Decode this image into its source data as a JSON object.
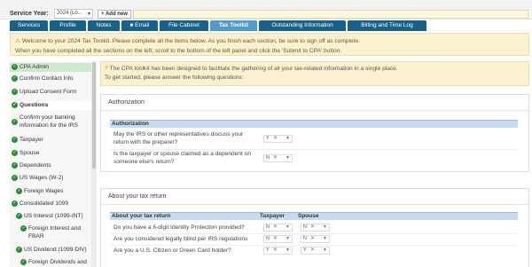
{
  "topbar": {
    "service_year_label": "Service Year:",
    "year_value": "2024 (Lo...",
    "add_new": "+ Add new"
  },
  "tabs": [
    {
      "label": "Services"
    },
    {
      "label": "Profile"
    },
    {
      "label": "Notes"
    },
    {
      "label": "Email"
    },
    {
      "label": "File Cabinet"
    },
    {
      "label": "Tax Toolkit"
    },
    {
      "label": "Outstanding Information"
    },
    {
      "label": "Billing and Time Log"
    }
  ],
  "banner": {
    "line1": "Welcome to your 2024 Tax Toolkit. Please complete all the items below. As you finish each section, be sure to sign off as complete.",
    "line2": "When you have completed all the sections on the left, scroll to the bottom of the left panel and click the 'Submit to CPA' button."
  },
  "sidebar": {
    "items": [
      {
        "label": "CPA Admin"
      },
      {
        "label": "Confirm Contact Info"
      },
      {
        "label": "Upload Consent Form"
      },
      {
        "label": "Questions"
      },
      {
        "label": "Confirm your banking"
      },
      {
        "label": "information for the IRS"
      },
      {
        "label": "Taxpayer"
      },
      {
        "label": "Spouse"
      },
      {
        "label": "Dependents"
      },
      {
        "label": "US Wages (W-2)"
      },
      {
        "label": "Foreign Wages"
      },
      {
        "label": "Consolidated 1099"
      },
      {
        "label": "US Interest (1099-INT)"
      },
      {
        "label": "Foreign Interest and"
      },
      {
        "label": "FBAR"
      },
      {
        "label": "US Dividend (1099-DIV)"
      },
      {
        "label": "Foreign Dividends and"
      }
    ]
  },
  "info": {
    "line1": "The CPA toolkit has been designed to facilitate the gathering of all your tax-related information in a single place.",
    "line2": "To get started, please answer the following questions:"
  },
  "authorization": {
    "panel_title": "Authorization",
    "section_header": "Authorization",
    "questions": [
      {
        "line1": "May the IRS or other representatives discuss your",
        "line2": "return with the preparer?",
        "value": "Y"
      },
      {
        "line1": "Is the taxpayer or spouse claimed as a dependent on",
        "line2": "someone else's return?",
        "value": "N"
      }
    ]
  },
  "about": {
    "panel_title": "About your tax return",
    "section_header": "About your tax return",
    "col_taxpayer": "Taxpayer",
    "col_spouse": "Spouse",
    "questions": [
      {
        "text": "Do you have a 6-digit Identity Protection provided?",
        "taxpayer": "N",
        "spouse": "N"
      },
      {
        "text": "Are you considered legally blind per IRS regulations",
        "taxpayer": "N",
        "spouse": "N"
      },
      {
        "text": "Are you a U.S. Citizen or Green Card holder?",
        "taxpayer": "Y",
        "spouse": "Y"
      }
    ]
  },
  "colors": {
    "tab_bg": "#17628d",
    "tab_active": "#4f9bcc",
    "banner_bg": "#fcf1cf",
    "check_green": "#2e8b3a",
    "section_header_bg": "#c5dcf0"
  },
  "icons": {
    "check": "check-circle-icon",
    "warning": "warning-icon",
    "help": "help-icon",
    "email": "email-icon"
  }
}
